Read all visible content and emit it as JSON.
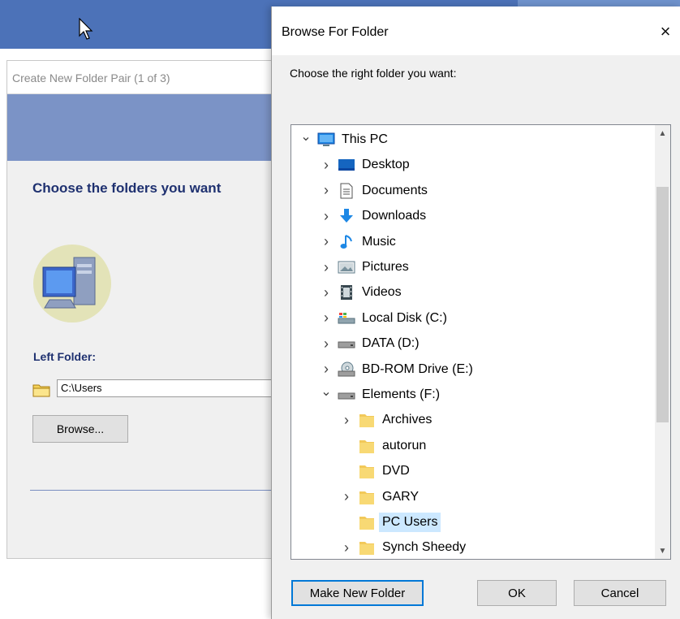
{
  "wizard": {
    "title": "Create New Folder Pair (1 of 3)",
    "heading": "Choose the folders you want",
    "left_folder_label": "Left Folder:",
    "path_value": "C:\\Users",
    "browse_label": "Browse..."
  },
  "dialog": {
    "title": "Browse For Folder",
    "close_glyph": "×",
    "instruction": "Choose the right folder you want:",
    "tree": [
      {
        "label": "This PC",
        "icon": "this-pc-icon",
        "level": 0,
        "expander": "expanded"
      },
      {
        "label": "Desktop",
        "icon": "desktop-icon",
        "level": 1,
        "expander": "collapsed"
      },
      {
        "label": "Documents",
        "icon": "documents-icon",
        "level": 1,
        "expander": "collapsed"
      },
      {
        "label": "Downloads",
        "icon": "downloads-icon",
        "level": 1,
        "expander": "collapsed"
      },
      {
        "label": "Music",
        "icon": "music-icon",
        "level": 1,
        "expander": "collapsed"
      },
      {
        "label": "Pictures",
        "icon": "pictures-icon",
        "level": 1,
        "expander": "collapsed"
      },
      {
        "label": "Videos",
        "icon": "videos-icon",
        "level": 1,
        "expander": "collapsed"
      },
      {
        "label": "Local Disk (C:)",
        "icon": "local-disk-icon",
        "level": 1,
        "expander": "collapsed"
      },
      {
        "label": "DATA (D:)",
        "icon": "drive-icon",
        "level": 1,
        "expander": "collapsed"
      },
      {
        "label": "BD-ROM Drive (E:)",
        "icon": "bd-rom-drive-icon",
        "level": 1,
        "expander": "collapsed"
      },
      {
        "label": "Elements (F:)",
        "icon": "drive-icon",
        "level": 1,
        "expander": "expanded"
      },
      {
        "label": "Archives",
        "icon": "folder-icon",
        "level": 2,
        "expander": "collapsed"
      },
      {
        "label": "autorun",
        "icon": "folder-icon",
        "level": 2,
        "expander": "none"
      },
      {
        "label": "DVD",
        "icon": "folder-icon",
        "level": 2,
        "expander": "none"
      },
      {
        "label": "GARY",
        "icon": "folder-icon",
        "level": 2,
        "expander": "collapsed"
      },
      {
        "label": "PC Users",
        "icon": "folder-icon",
        "level": 2,
        "expander": "none",
        "selected": true
      },
      {
        "label": "Synch Sheedy",
        "icon": "folder-icon",
        "level": 2,
        "expander": "collapsed"
      }
    ],
    "buttons": {
      "make_new_folder": "Make New Folder",
      "ok": "OK",
      "cancel": "Cancel"
    }
  },
  "colors": {
    "accent": "#0078d7",
    "selection": "#cce8ff",
    "heading_navy": "#1f3170",
    "header_blue": "#7b93c6"
  }
}
